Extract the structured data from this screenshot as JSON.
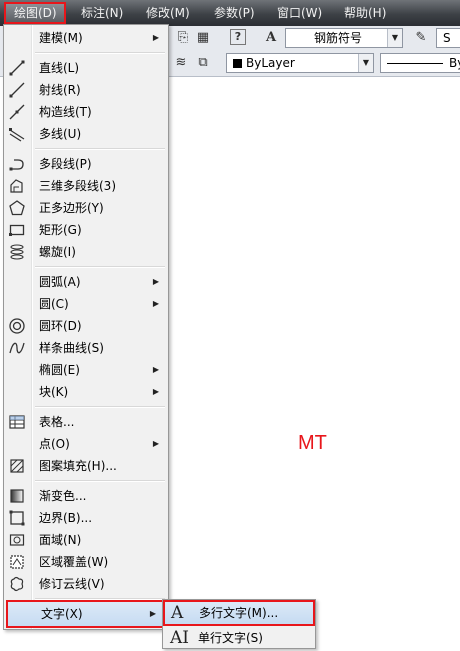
{
  "menubar": {
    "items": [
      "绘图(D)",
      "标注(N)",
      "修改(M)",
      "参数(P)",
      "窗口(W)",
      "帮助(H)"
    ]
  },
  "toolbar": {
    "text_style_combo": "钢筋符号",
    "text_style_combo_right": "S",
    "layer_combo": "ByLayer",
    "linetype_combo": "By"
  },
  "draw_menu": {
    "items": [
      {
        "label": "建模(M)",
        "submenu": true,
        "icon": "none"
      },
      {
        "label": "直线(L)",
        "icon": "line-icon"
      },
      {
        "label": "射线(R)",
        "icon": "ray-icon"
      },
      {
        "label": "构造线(T)",
        "icon": "construction-line-icon"
      },
      {
        "label": "多线(U)",
        "icon": "multiline-icon"
      },
      {
        "label": "多段线(P)",
        "icon": "polyline-icon"
      },
      {
        "label": "三维多段线(3)",
        "icon": "3d-polyline-icon"
      },
      {
        "label": "正多边形(Y)",
        "icon": "polygon-icon"
      },
      {
        "label": "矩形(G)",
        "icon": "rectangle-icon"
      },
      {
        "label": "螺旋(I)",
        "icon": "helix-icon"
      },
      {
        "label": "圆弧(A)",
        "submenu": true,
        "icon": "none"
      },
      {
        "label": "圆(C)",
        "submenu": true,
        "icon": "none"
      },
      {
        "label": "圆环(D)",
        "icon": "donut-icon"
      },
      {
        "label": "样条曲线(S)",
        "icon": "spline-icon"
      },
      {
        "label": "椭圆(E)",
        "submenu": true,
        "icon": "none"
      },
      {
        "label": "块(K)",
        "submenu": true,
        "icon": "none"
      },
      {
        "label": "表格...",
        "icon": "table-icon"
      },
      {
        "label": "点(O)",
        "submenu": true,
        "icon": "none"
      },
      {
        "label": "图案填充(H)...",
        "icon": "hatch-icon"
      },
      {
        "label": "渐变色...",
        "icon": "gradient-icon"
      },
      {
        "label": "边界(B)...",
        "icon": "boundary-icon"
      },
      {
        "label": "面域(N)",
        "icon": "region-icon"
      },
      {
        "label": "区域覆盖(W)",
        "icon": "wipeout-icon"
      },
      {
        "label": "修订云线(V)",
        "icon": "revcloud-icon"
      },
      {
        "label": "文字(X)",
        "submenu": true,
        "icon": "none",
        "highlighted": true
      }
    ]
  },
  "text_submenu": {
    "items": [
      {
        "label": "多行文字(M)...",
        "icon_glyph": "A",
        "highlighted": true
      },
      {
        "label": "单行文字(S)",
        "icon_glyph": "AI"
      }
    ]
  },
  "canvas": {
    "annotation": "MT",
    "annotation_color": "#e8161b"
  },
  "colors": {
    "highlight_border": "#e8161b",
    "menu_background": "#f1f1f1",
    "menubar_dark": "#3d4146"
  }
}
